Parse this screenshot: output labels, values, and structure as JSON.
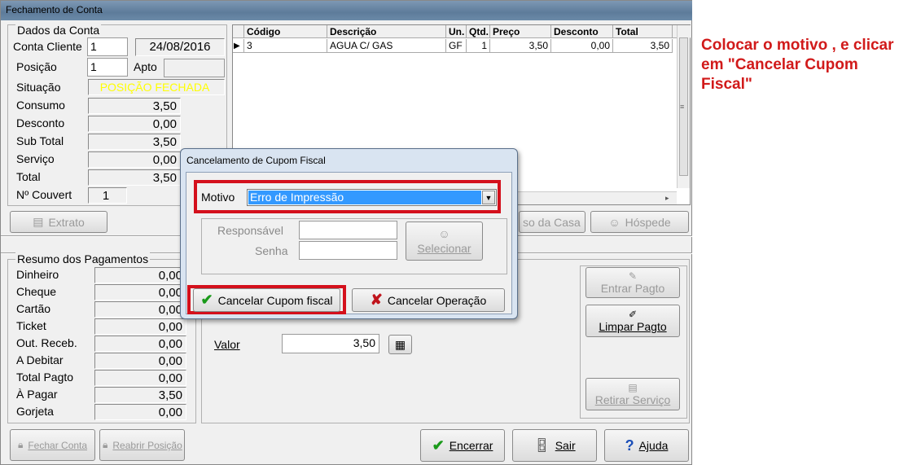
{
  "window": {
    "title": "Fechamento de Conta"
  },
  "dados": {
    "header": "Dados da Conta",
    "conta_label": "Conta Cliente",
    "conta_value": "1",
    "date": "24/08/2016",
    "posicao_label": "Posição",
    "posicao_value": "1",
    "apto_label": "Apto",
    "apto_value": "",
    "situacao_label": "Situação",
    "situacao_value": "POSIÇÃO FECHADA",
    "rows": [
      {
        "label": "Consumo",
        "value": "3,50"
      },
      {
        "label": "Desconto",
        "value": "0,00"
      },
      {
        "label": "Sub Total",
        "value": "3,50"
      },
      {
        "label": "Serviço",
        "value": "0,00"
      },
      {
        "label": "Total",
        "value": "3,50"
      }
    ],
    "couvert_label": "Nº Couvert",
    "couvert_value": "1"
  },
  "grid": {
    "headers": [
      "Código",
      "Descrição",
      "Un.",
      "Qtd.",
      "Preço",
      "Desconto",
      "Total"
    ],
    "rows": [
      {
        "codigo": "3",
        "descricao": "AGUA C/ GAS",
        "un": "GF",
        "qtd": "1",
        "preco": "3,50",
        "desconto": "0,00",
        "total": "3,50"
      }
    ]
  },
  "buttons": {
    "extrato": "Extrato",
    "uso_casa": "so da Casa",
    "hospede": "Hóspede",
    "entrar_pagto": "Entrar Pagto",
    "limpar_pagto": "Limpar Pagto",
    "retirar_servico": "Retirar Serviço",
    "fechar_conta": "Fechar Conta",
    "reabrir_posicao": "Reabrir Posição",
    "encerrar": "Encerrar",
    "sair": "Sair",
    "ajuda": "Ajuda"
  },
  "pagamentos": {
    "header": "Resumo dos Pagamentos",
    "rows": [
      {
        "label": "Dinheiro",
        "value": "0,00"
      },
      {
        "label": "Cheque",
        "value": "0,00"
      },
      {
        "label": "Cartão",
        "value": "0,00"
      },
      {
        "label": "Ticket",
        "value": "0,00"
      },
      {
        "label": "Out. Receb.",
        "value": "0,00"
      },
      {
        "label": "A Debitar",
        "value": "0,00"
      },
      {
        "label": "Total Pagto",
        "value": "0,00"
      },
      {
        "label": "À Pagar",
        "value": "3,50"
      },
      {
        "label": "Gorjeta",
        "value": "0,00"
      }
    ]
  },
  "valor": {
    "label": "Valor",
    "value": "3,50"
  },
  "dialog": {
    "title": "Cancelamento de Cupom Fiscal",
    "motivo_label": "Motivo",
    "motivo_value": "Erro de Impressão",
    "responsavel_label": "Responsável",
    "senha_label": "Senha",
    "selecionar": "Selecionar",
    "cancelar_cupom": "Cancelar Cupom fiscal",
    "cancelar_operacao": "Cancelar Operação"
  },
  "note": "Colocar o motivo , e clicar em \"Cancelar Cupom Fiscal\"",
  "colors": {
    "highlight": "#d4101c",
    "situacao": "#ffff00",
    "note": "#d11a1a"
  }
}
